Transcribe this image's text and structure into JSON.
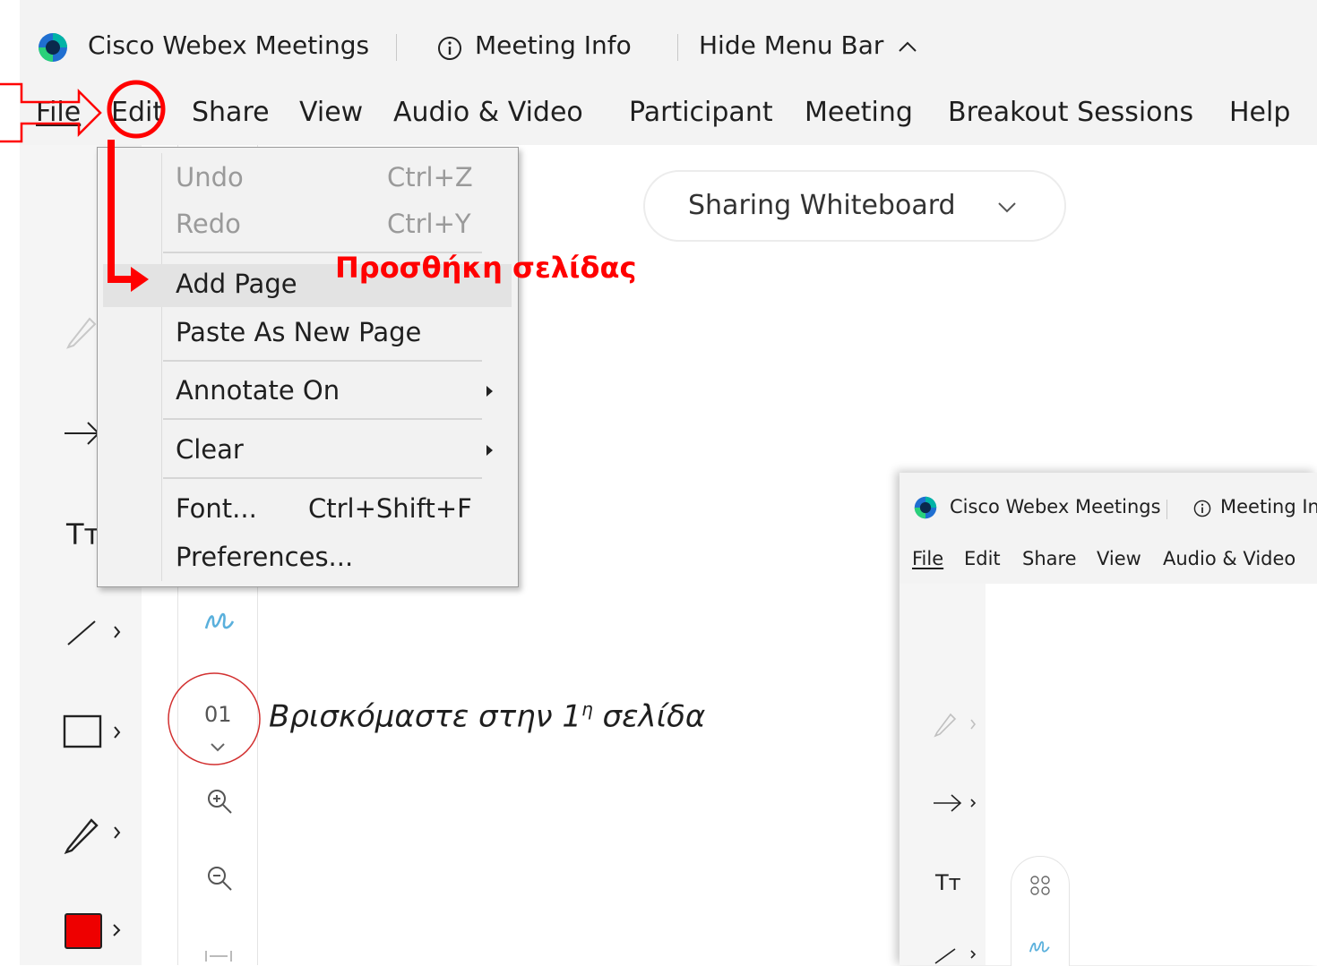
{
  "window": {
    "app_name": "Cisco Webex Meetings",
    "meeting_info": "Meeting Info",
    "hide_menu_bar": "Hide Menu Bar"
  },
  "menubar": {
    "items": [
      "File",
      "Edit",
      "Share",
      "View",
      "Audio & Video",
      "Participant",
      "Meeting",
      "Breakout Sessions",
      "Help"
    ]
  },
  "share_status": "Sharing Whiteboard",
  "edit_menu": {
    "undo": "Undo",
    "undo_shortcut": "Ctrl+Z",
    "redo": "Redo",
    "redo_shortcut": "Ctrl+Y",
    "add_page": "Add Page",
    "paste_as_new_page": "Paste As New Page",
    "annotate_on": "Annotate On",
    "clear": "Clear",
    "font": "Font...",
    "font_shortcut": "Ctrl+Shift+F",
    "preferences": "Preferences..."
  },
  "annotations": {
    "add_page_caption": "Προσθήκη σελίδας",
    "page_caption_prefix": "Βρισκόμαστε στην 1",
    "page_caption_sup": "η",
    "page_caption_suffix": " σελίδα"
  },
  "tool_rail": {
    "page_number": "01",
    "text_tool": "Tт",
    "fill_color": "#ee0000"
  },
  "inset_window": {
    "app_name": "Cisco Webex Meetings",
    "meeting_info": "Meeting Inf",
    "menu_items": [
      "File",
      "Edit",
      "Share",
      "View",
      "Audio & Video"
    ],
    "text_tool": "Tт"
  },
  "colors": {
    "annotation_red": "#ff0000",
    "webex_teal": "#00b3a6",
    "webex_blue": "#1f6fd1"
  }
}
